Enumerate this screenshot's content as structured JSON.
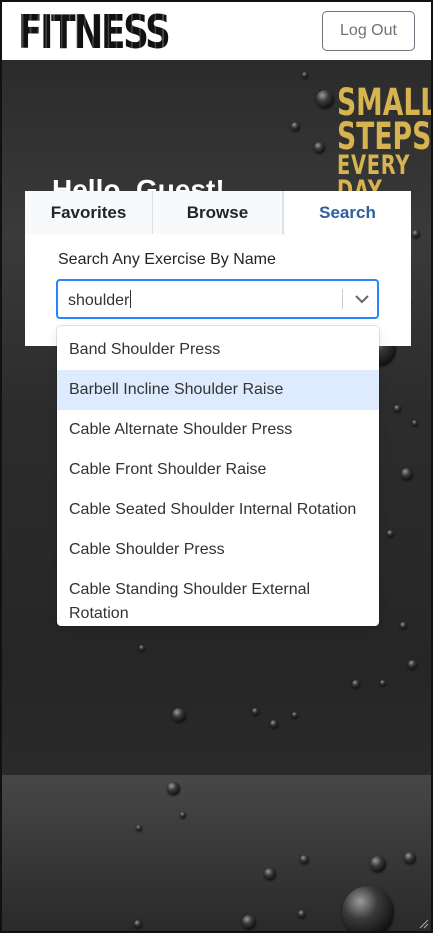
{
  "header": {
    "logo_text": "FITNESS",
    "logout_label": "Log Out"
  },
  "hero": {
    "greeting": "Hello, Guest!",
    "slogan": [
      "SMALL",
      "STEPS",
      "EVERY DAY"
    ]
  },
  "tabs": [
    {
      "label": "Favorites",
      "active": false
    },
    {
      "label": "Browse",
      "active": false
    },
    {
      "label": "Search",
      "active": true
    }
  ],
  "search": {
    "label": "Search Any Exercise By Name",
    "value": "shoulder"
  },
  "options": [
    {
      "label": "Band Shoulder Press",
      "highlighted": false
    },
    {
      "label": "Barbell Incline Shoulder Raise",
      "highlighted": true
    },
    {
      "label": "Cable Alternate Shoulder Press",
      "highlighted": false
    },
    {
      "label": "Cable Front Shoulder Raise",
      "highlighted": false
    },
    {
      "label": "Cable Seated Shoulder Internal Rotation",
      "highlighted": false
    },
    {
      "label": "Cable Shoulder Press",
      "highlighted": false
    },
    {
      "label": "Cable Standing Shoulder External Rotation",
      "highlighted": false
    }
  ],
  "icons": {
    "dropdown": "chevron-down-icon",
    "resize": "resize-handle-icon"
  },
  "colors": {
    "accent_tab": "#2c5f9e",
    "focus_border": "#2684ff",
    "option_highlight": "#deebff",
    "slogan_gold": "#d7b450"
  }
}
